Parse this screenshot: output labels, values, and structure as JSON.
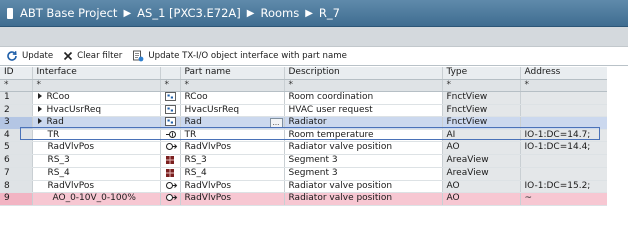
{
  "breadcrumb": [
    "ABT Base Project",
    "AS_1 [PXC3.E72A]",
    "Rooms",
    "R_7"
  ],
  "toolbar": {
    "update_label": "Update",
    "clear_filter_label": "Clear filter",
    "update_tx_label": "Update TX-I/O object interface with part name"
  },
  "columns": {
    "id": "ID",
    "interface": "Interface",
    "part_name": "Part name",
    "description": "Description",
    "type": "Type",
    "address": "Address"
  },
  "filter": {
    "id": "*",
    "interface": "*",
    "icon": "*",
    "part_name": "*",
    "description": "*",
    "type": "*",
    "address": "*"
  },
  "rows": [
    {
      "id": "1",
      "interface": "RCoo",
      "expandable": true,
      "icon": "module-icon",
      "part_name": "RCoo",
      "description": "Room coordination",
      "type": "FnctView",
      "address": ""
    },
    {
      "id": "2",
      "interface": "HvacUsrReq",
      "expandable": true,
      "icon": "module-icon",
      "part_name": "HvacUsrReq",
      "description": "HVAC user request",
      "type": "FnctView",
      "address": ""
    },
    {
      "id": "3",
      "interface": "Rad",
      "expandable": true,
      "icon": "module-icon",
      "part_name": "Rad",
      "description": "Radiator",
      "type": "FnctView",
      "address": "",
      "selected": true
    },
    {
      "id": "4",
      "interface": "TR",
      "expandable": false,
      "icon": "sensor-icon",
      "part_name": "TR",
      "description": "Room temperature",
      "type": "AI",
      "address": "IO-1:DC=14.7;"
    },
    {
      "id": "5",
      "interface": "RadVlvPos",
      "expandable": false,
      "icon": "valve-icon",
      "part_name": "RadVlvPos",
      "description": "Radiator valve position",
      "type": "AO",
      "address": "IO-1:DC=14.4;"
    },
    {
      "id": "6",
      "interface": "RS_3",
      "expandable": false,
      "icon": "segment-icon",
      "part_name": "RS_3",
      "description": "Segment 3",
      "type": "AreaView",
      "address": ""
    },
    {
      "id": "7",
      "interface": "RS_4",
      "expandable": false,
      "icon": "segment-icon",
      "part_name": "RS_4",
      "description": "Segment 3",
      "type": "AreaView",
      "address": ""
    },
    {
      "id": "8",
      "interface": "RadVlvPos",
      "expandable": false,
      "icon": "valve-icon",
      "part_name": "RadVlvPos",
      "description": "Radiator valve position",
      "type": "AO",
      "address": "IO-1:DC=15.2;"
    },
    {
      "id": "9",
      "interface": "AO_0-10V_0-100%",
      "expandable": false,
      "icon": "valve-icon",
      "part_name": "RadVlvPos",
      "description": "Radiator valve position",
      "type": "AO",
      "address": "~",
      "error": true
    }
  ],
  "colors": {
    "header_bar": "#4a7799",
    "selected_row": "#cbd8ee",
    "error_row": "#f7c7d2"
  }
}
